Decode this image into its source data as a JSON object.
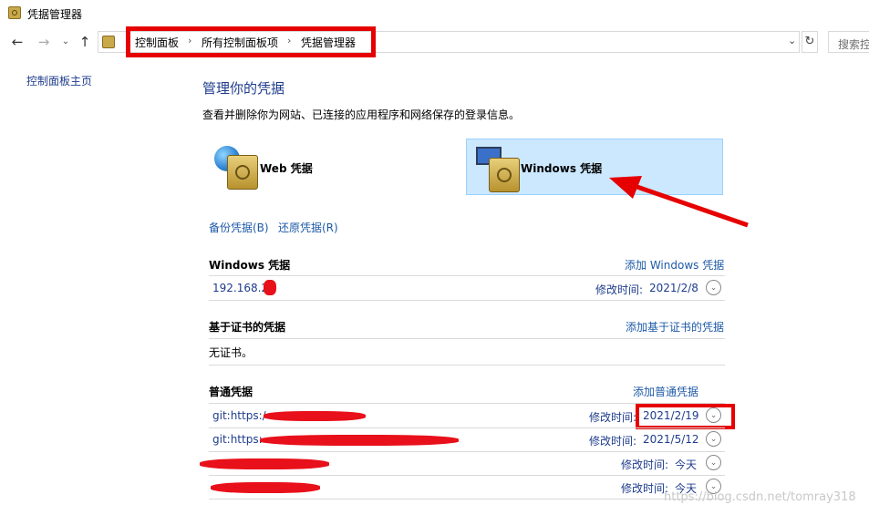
{
  "window": {
    "title": "凭据管理器"
  },
  "nav": {
    "breadcrumbs": [
      "控制面板",
      "所有控制面板项",
      "凭据管理器"
    ],
    "search_placeholder": "搜索控",
    "back_icon": "arrow-left-icon",
    "forward_icon": "arrow-right-icon",
    "up_icon": "arrow-up-icon",
    "refresh_icon": "refresh-icon"
  },
  "sidebar": {
    "home": "控制面板主页"
  },
  "main": {
    "title": "管理你的凭据",
    "description": "查看并删除你为网站、已连接的应用程序和网络保存的登录信息。",
    "tiles": [
      {
        "label": "Web 凭据",
        "selected": false
      },
      {
        "label": "Windows 凭据",
        "selected": true
      }
    ],
    "backup": "备份凭据(B)",
    "restore": "还原凭据(R)",
    "sections": {
      "windows": {
        "title": "Windows 凭据",
        "add": "添加 Windows 凭据",
        "rows": [
          {
            "name": "192.168.2.",
            "modified_label": "修改时间:",
            "date": "2021/2/8"
          }
        ]
      },
      "cert": {
        "title": "基于证书的凭据",
        "add": "添加基于证书的凭据",
        "empty": "无证书。"
      },
      "generic": {
        "title": "普通凭据",
        "add": "添加普通凭据",
        "rows": [
          {
            "name": "git:https:/",
            "modified_label": "修改时间:",
            "date": "2021/2/19"
          },
          {
            "name": "git:https:",
            "modified_label": "修改时间:",
            "date": "2021/5/12"
          },
          {
            "name": "",
            "modified_label": "修改时间:",
            "date": "今天"
          },
          {
            "name": "",
            "modified_label": "修改时间:",
            "date": "今天"
          }
        ]
      }
    }
  },
  "watermark": "https://blog.csdn.net/tomray318",
  "colors": {
    "accent": "#1e3c8c",
    "selected_tile": "#cce8ff",
    "annotation_red": "#e60000"
  }
}
